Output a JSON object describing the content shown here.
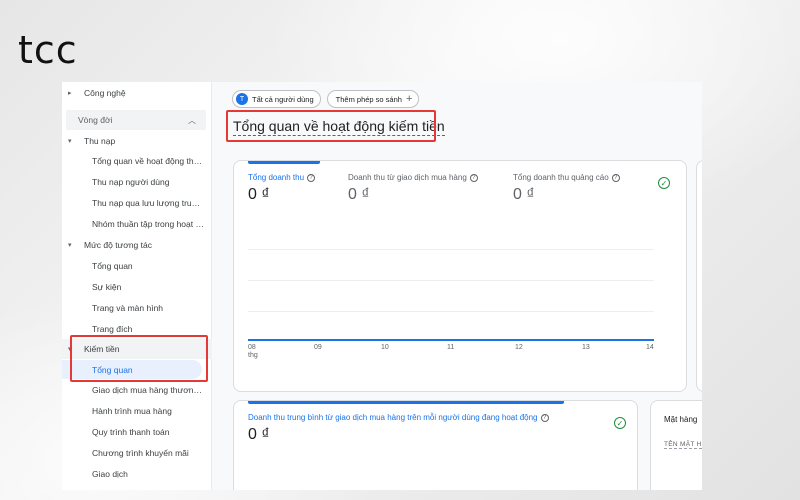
{
  "logo": "tcc",
  "sidebar": {
    "top_item": "Công nghệ",
    "group_label": "Vòng đời",
    "sections": [
      {
        "label": "Thu nạp",
        "items": [
          "Tổng quan về hoạt động thu nạp",
          "Thu nạp người dùng",
          "Thu nạp qua lưu lượng truy cập",
          "Nhóm thuần tập trong hoạt động thu nạp"
        ]
      },
      {
        "label": "Mức độ tương tác",
        "items": [
          "Tổng quan",
          "Sự kiện",
          "Trang và màn hình",
          "Trang đích"
        ]
      },
      {
        "label": "Kiếm tiền",
        "items": [
          "Tổng quan",
          "Giao dịch mua hàng thương mại điện tử",
          "Hành trình mua hàng",
          "Quy trình thanh toán",
          "Chương trình khuyến mãi",
          "Giao dịch"
        ]
      }
    ]
  },
  "header": {
    "segment_chip": "Tất cả người dùng",
    "segment_avatar": "T",
    "compare_chip": "Thêm phép so sánh",
    "title": "Tổng quan về hoạt động kiếm tiền"
  },
  "main_card": {
    "metrics": [
      {
        "label": "Tổng doanh thu",
        "value": "0 ₫"
      },
      {
        "label": "Doanh thu từ giao dịch mua hàng",
        "value": "0 ₫"
      },
      {
        "label": "Tổng doanh thu quảng cáo",
        "value": "0 ₫"
      }
    ],
    "x_ticks": [
      "08",
      "09",
      "10",
      "11",
      "12",
      "13",
      "14"
    ],
    "x_month": "thg"
  },
  "arpu_card": {
    "label": "Doanh thu trung bình từ giao dịch mua hàng trên mỗi người dùng đang hoạt động",
    "value": "0 ₫"
  },
  "side_card": {
    "title": "Mặt hàng",
    "column": "TÊN MẶT H"
  },
  "colors": {
    "accent": "#1a73e8",
    "highlight": "#e53935",
    "success": "#1e8e3e"
  }
}
